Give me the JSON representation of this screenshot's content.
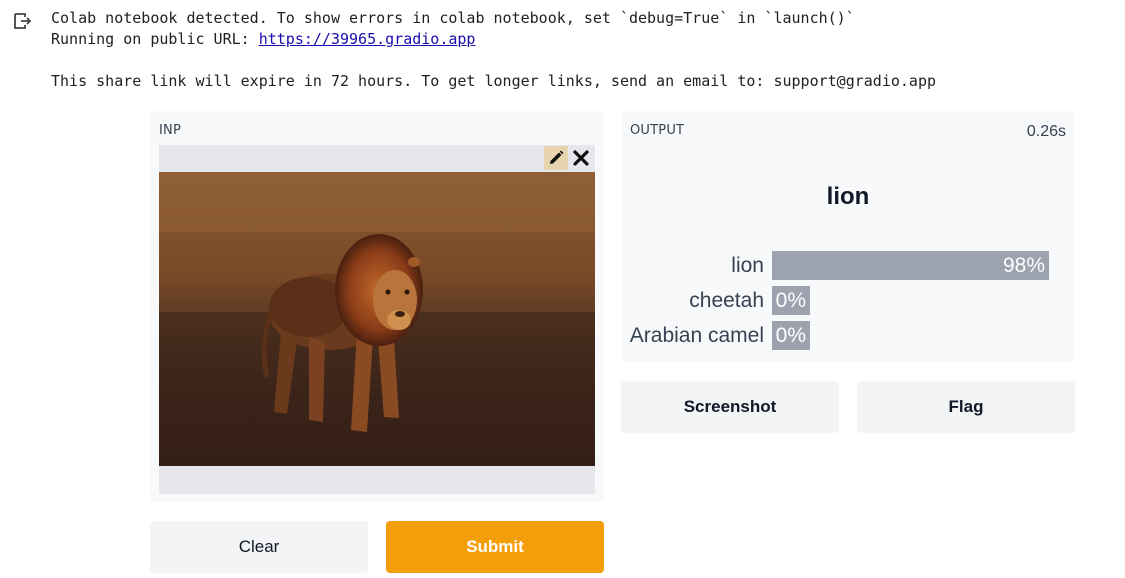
{
  "console": {
    "line1": "Colab notebook detected. To show errors in colab notebook, set `debug=True` in `launch()`",
    "line2_prefix": "Running on public URL: ",
    "line2_link": "https://39965.gradio.app",
    "line3": "This share link will expire in 72 hours. To get longer links, send an email to: support@gradio.app"
  },
  "input_panel": {
    "label": "INP",
    "edit_icon": "pencil-icon",
    "clear_icon": "close-icon"
  },
  "output_panel": {
    "label": "OUTPUT",
    "duration": "0.26s",
    "top_label": "lion",
    "confidences": [
      {
        "label": "lion",
        "pct_text": "98%",
        "value": 0.98
      },
      {
        "label": "cheetah",
        "pct_text": "0%",
        "value": 0.0
      },
      {
        "label": "Arabian camel",
        "pct_text": "0%",
        "value": 0.0
      }
    ]
  },
  "buttons": {
    "clear": "Clear",
    "submit": "Submit",
    "screenshot": "Screenshot",
    "flag": "Flag"
  },
  "colors": {
    "accent": "#f59e0b",
    "bar": "#9ca3af",
    "panel_bg": "#f8f9fa",
    "button_bg": "#f3f4f6"
  }
}
